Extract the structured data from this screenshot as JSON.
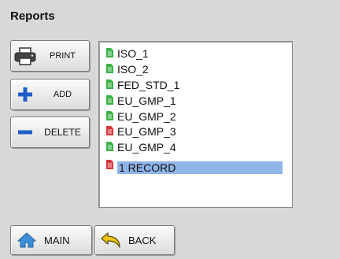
{
  "header": {
    "title": "Reports"
  },
  "actions": {
    "print_label": "PRINT",
    "add_label": "ADD",
    "delete_label": "DELETE"
  },
  "reports": [
    {
      "name": "ISO_1",
      "icon": "document-green-icon"
    },
    {
      "name": "ISO_2",
      "icon": "document-green-icon"
    },
    {
      "name": "FED_STD_1",
      "icon": "document-green-icon"
    },
    {
      "name": "EU_GMP_1",
      "icon": "document-green-icon"
    },
    {
      "name": "EU_GMP_2",
      "icon": "document-green-icon"
    },
    {
      "name": "EU_GMP_3",
      "icon": "document-red-icon"
    },
    {
      "name": "EU_GMP_4",
      "icon": "document-green-icon"
    },
    {
      "name": "1 RECORD",
      "icon": "document-red-icon",
      "selected": true
    }
  ],
  "nav": {
    "main_label": "MAIN",
    "back_label": "BACK"
  },
  "colors": {
    "background": "#d8d8d8",
    "selection": "#8fb4e8",
    "doc_green": "#3cb34a",
    "doc_red": "#d9373c",
    "add_blue": "#1e5ec8",
    "back_yellow": "#f2c417"
  }
}
